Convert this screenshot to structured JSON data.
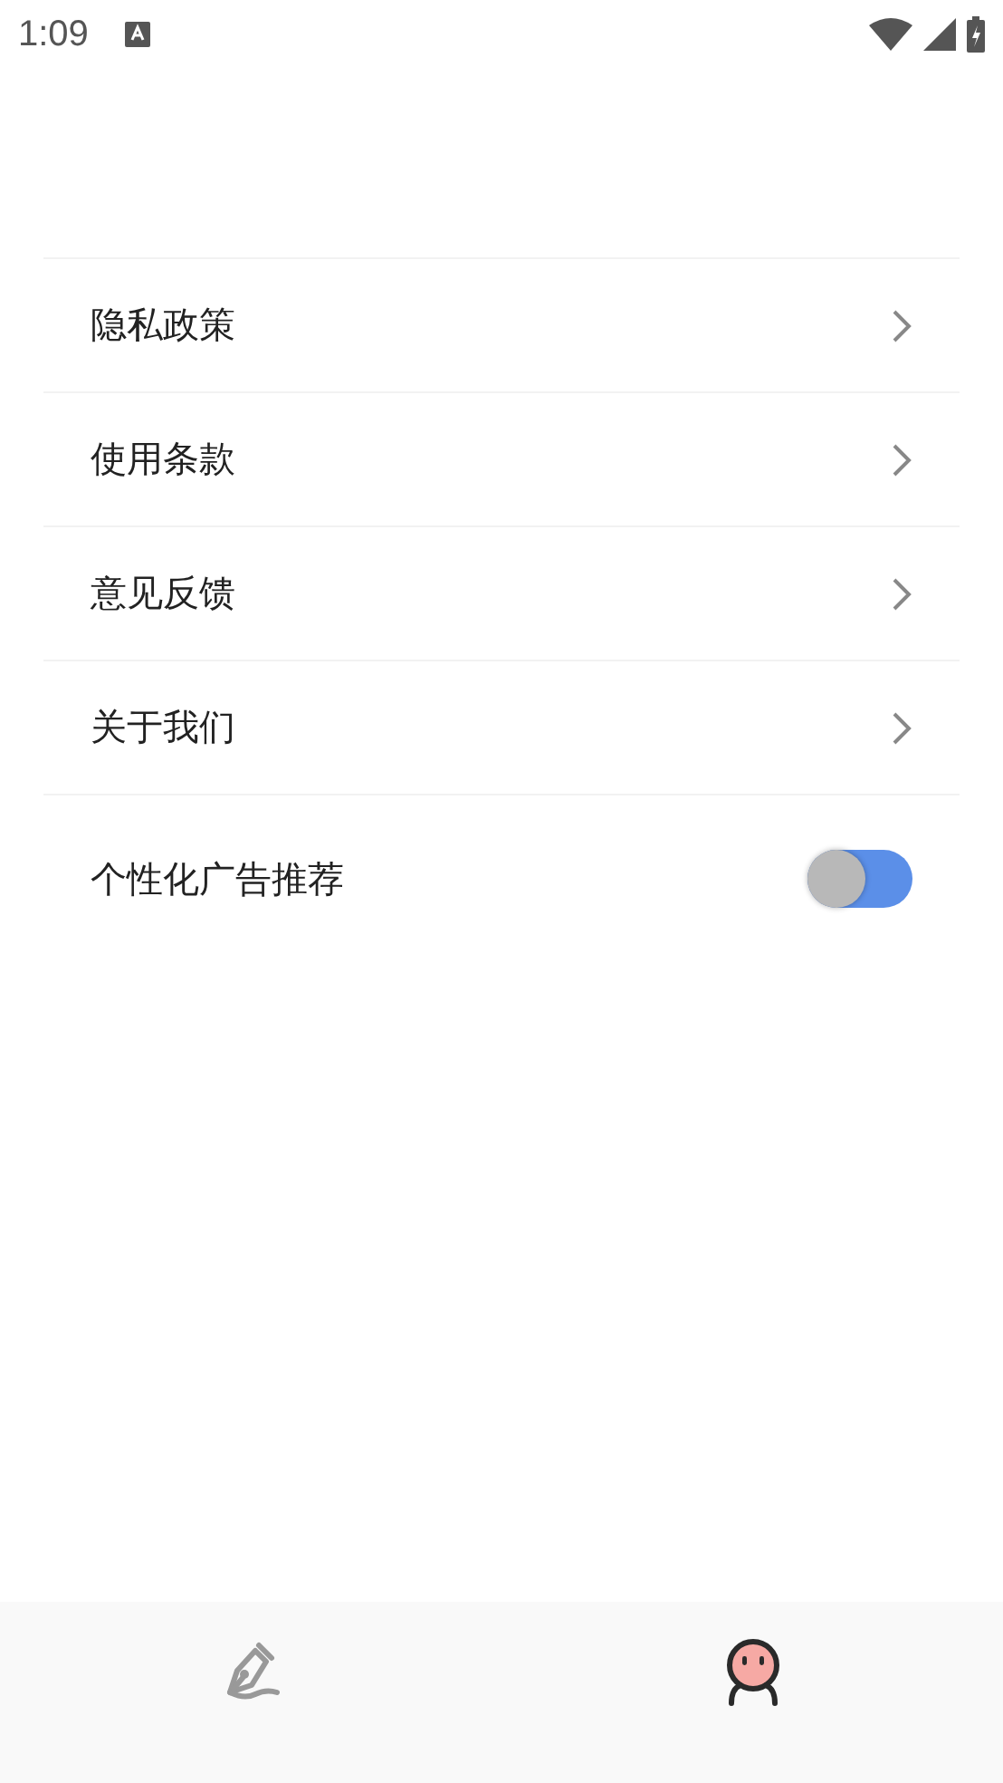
{
  "status_bar": {
    "time": "1:09"
  },
  "menu": [
    {
      "kind": "link",
      "label": "隐私政策"
    },
    {
      "kind": "link",
      "label": "使用条款"
    },
    {
      "kind": "link",
      "label": "意见反馈"
    },
    {
      "kind": "link",
      "label": "关于我们"
    },
    {
      "kind": "toggle",
      "label": "个性化广告推荐",
      "on": false
    }
  ],
  "bottom_nav": [
    {
      "kind": "pen",
      "selected": false
    },
    {
      "kind": "face",
      "selected": true
    }
  ]
}
